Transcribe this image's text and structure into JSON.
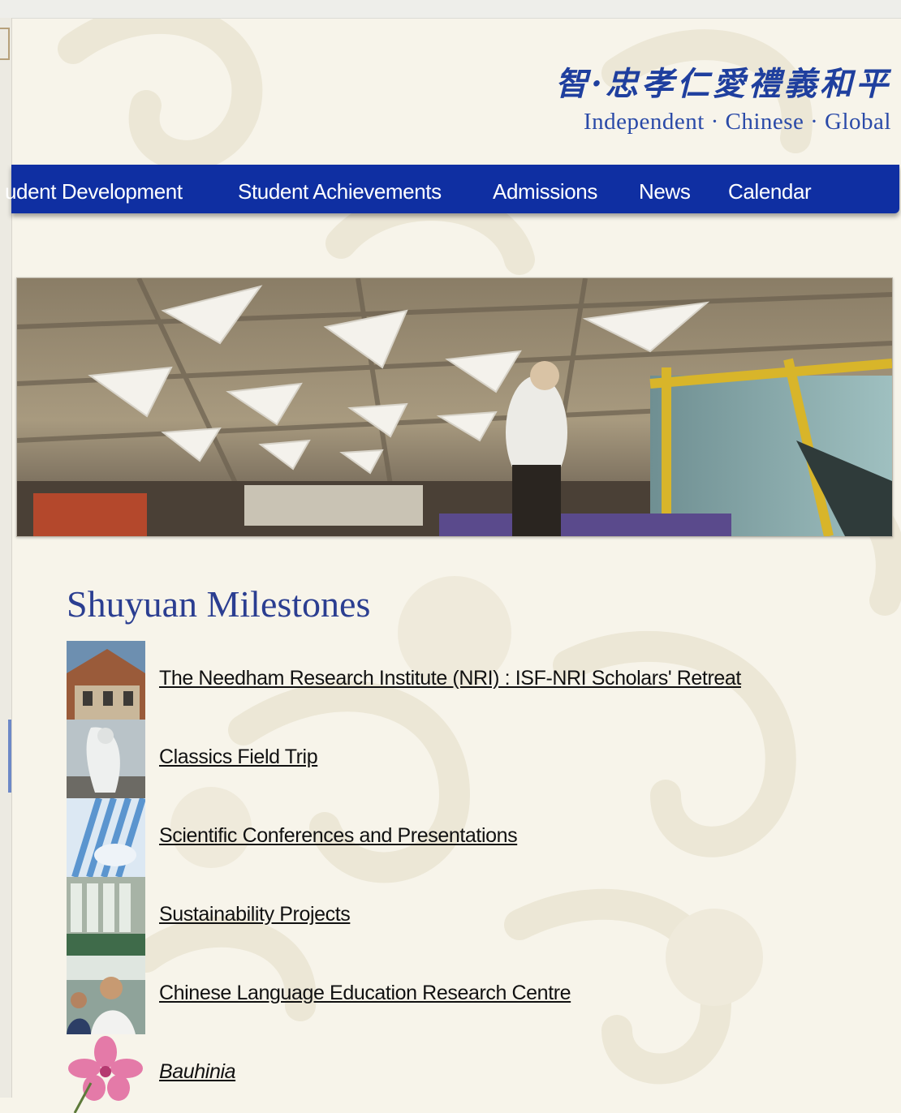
{
  "header": {
    "motto_chinese": "智·忠孝仁愛禮義和平",
    "motto_english": "Independent · Chinese · Global"
  },
  "nav": {
    "items": [
      {
        "label": "udent Development"
      },
      {
        "label": "Student Achievements"
      },
      {
        "label": "Admissions"
      },
      {
        "label": "News"
      },
      {
        "label": "Calendar"
      }
    ]
  },
  "main": {
    "section_title": "Shuyuan Milestones",
    "milestones": [
      {
        "label": "The Needham Research Institute (NRI) : ISF-NRI Scholars' Retreat",
        "thumb": "campus-buildings-thumbnail"
      },
      {
        "label": "Classics Field Trip",
        "thumb": "classical-statue-thumbnail"
      },
      {
        "label": "Scientific Conferences and Presentations",
        "thumb": "conference-thumbnail"
      },
      {
        "label": "Sustainability Projects",
        "thumb": "green-building-thumbnail"
      },
      {
        "label": "Chinese Language Education Research Centre",
        "thumb": "students-thumbnail"
      },
      {
        "label": "Bauhinia",
        "thumb": "bauhinia-flower-thumbnail"
      }
    ]
  },
  "colors": {
    "nav_background": "#0f2fa2",
    "title_blue": "#2b3e91",
    "page_background": "#f7f4ea"
  }
}
